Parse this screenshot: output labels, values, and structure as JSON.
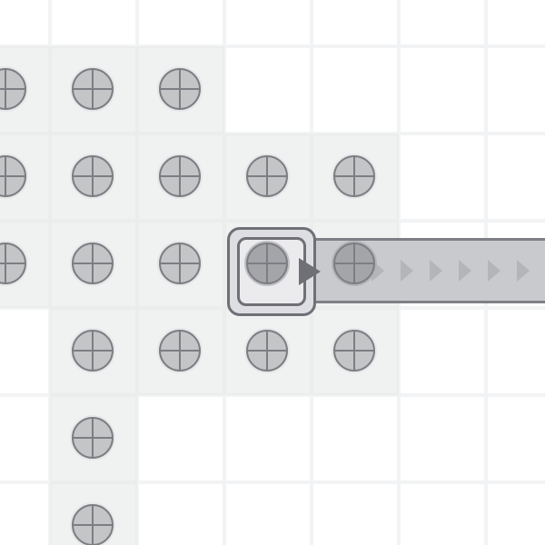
{
  "board": {
    "columns": 7,
    "rows": 7,
    "filled_cells": [
      [
        0,
        1
      ],
      [
        1,
        1
      ],
      [
        2,
        1
      ],
      [
        0,
        2
      ],
      [
        1,
        2
      ],
      [
        2,
        2
      ],
      [
        3,
        2
      ],
      [
        4,
        2
      ],
      [
        0,
        3
      ],
      [
        1,
        3
      ],
      [
        2,
        3
      ],
      [
        3,
        3
      ],
      [
        4,
        3
      ],
      [
        1,
        4
      ],
      [
        2,
        4
      ],
      [
        3,
        4
      ],
      [
        4,
        4
      ],
      [
        1,
        5
      ],
      [
        1,
        6
      ]
    ],
    "studs": [
      {
        "cell": [
          0,
          1
        ],
        "state": "idle"
      },
      {
        "cell": [
          1,
          1
        ],
        "state": "idle"
      },
      {
        "cell": [
          2,
          1
        ],
        "state": "idle"
      },
      {
        "cell": [
          0,
          2
        ],
        "state": "idle"
      },
      {
        "cell": [
          1,
          2
        ],
        "state": "idle"
      },
      {
        "cell": [
          2,
          2
        ],
        "state": "idle"
      },
      {
        "cell": [
          3,
          2
        ],
        "state": "idle"
      },
      {
        "cell": [
          4,
          2
        ],
        "state": "idle"
      },
      {
        "cell": [
          0,
          3
        ],
        "state": "idle"
      },
      {
        "cell": [
          1,
          3
        ],
        "state": "idle"
      },
      {
        "cell": [
          2,
          3
        ],
        "state": "idle"
      },
      {
        "cell": [
          3,
          3
        ],
        "state": "selected"
      },
      {
        "cell": [
          4,
          3
        ],
        "state": "on-track"
      },
      {
        "cell": [
          1,
          4
        ],
        "state": "idle"
      },
      {
        "cell": [
          2,
          4
        ],
        "state": "idle"
      },
      {
        "cell": [
          3,
          4
        ],
        "state": "idle"
      },
      {
        "cell": [
          4,
          4
        ],
        "state": "idle"
      },
      {
        "cell": [
          1,
          5
        ],
        "state": "idle"
      },
      {
        "cell": [
          1,
          6
        ],
        "state": "idle"
      }
    ],
    "selected_cell": [
      3,
      3
    ],
    "track": {
      "direction": "right",
      "chevron_count": 7
    }
  },
  "icons": {
    "stud": "crosshair-stud-icon",
    "pointer": "play-triangle-icon",
    "chevron": "chevron-right-icon"
  },
  "colors": {
    "empty_tile": "#ffffff",
    "filled_tile": "#f0f1f1",
    "stud_fill": "#c4c5c7",
    "stud_selected_fill": "#a4a5a8",
    "stud_stroke": "#7d7e83",
    "track_fill": "#c9cacd",
    "accent_dark": "#6f7076"
  }
}
